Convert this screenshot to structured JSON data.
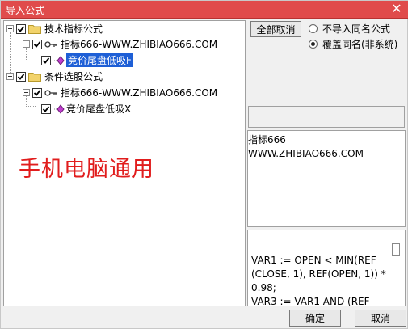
{
  "window": {
    "title": "导入公式"
  },
  "tree": {
    "nodes": [
      {
        "label": "技术指标公式",
        "checked": true,
        "type": "folder"
      },
      {
        "label": "指标666-WWW.ZHIBIAO666.COM",
        "checked": true,
        "type": "key"
      },
      {
        "label": "竞价尾盘低吸F",
        "checked": true,
        "type": "formula",
        "selected": true
      },
      {
        "label": "条件选股公式",
        "checked": true,
        "type": "folder"
      },
      {
        "label": "指标666-WWW.ZHIBIAO666.COM",
        "checked": true,
        "type": "key"
      },
      {
        "label": "竞价尾盘低吸X",
        "checked": true,
        "type": "formula",
        "selected": false
      }
    ]
  },
  "overlay_text": "手机电脑通用",
  "right_panel": {
    "cancel_all_label": "全部取消",
    "radio_options": [
      {
        "label": "不导入同名公式",
        "selected": false
      },
      {
        "label": "覆盖同名(非系统)",
        "selected": true
      }
    ],
    "info_lines": [
      "指标666",
      "WWW.ZHIBIAO666.COM"
    ],
    "code_lines": [
      "VAR1 := OPEN < MIN(REF",
      "(CLOSE, 1), REF(OPEN, 1)) *",
      "0.98;",
      "VAR3 := VAR1 AND (REF"
    ]
  },
  "buttons": {
    "ok_label": "确定",
    "cancel_label": "取消"
  },
  "colors": {
    "title_bar": "#e04b4b",
    "selection": "#1e5fd6",
    "overlay_text": "#e11d1d"
  }
}
